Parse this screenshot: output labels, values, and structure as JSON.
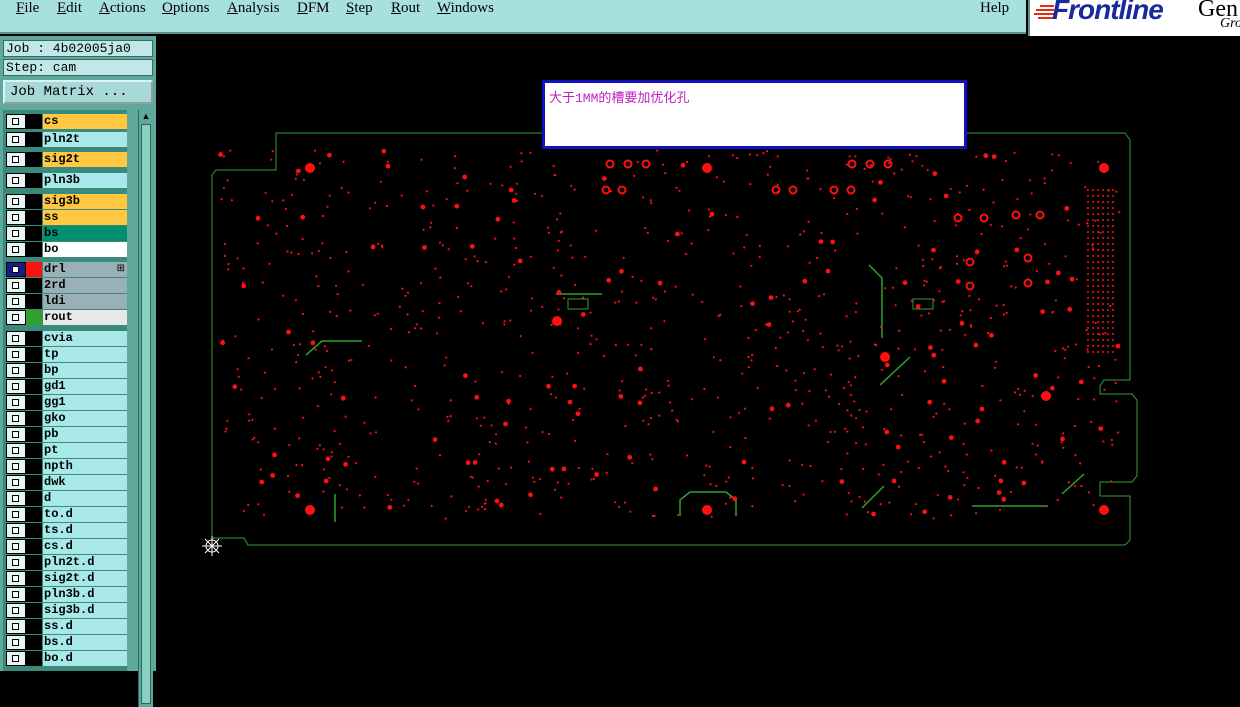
{
  "menu": {
    "file": {
      "u": "F",
      "rest": "ile"
    },
    "edit": {
      "u": "E",
      "rest": "dit"
    },
    "actions": {
      "u": "A",
      "rest": "ctions"
    },
    "options": {
      "u": "O",
      "rest": "ptions"
    },
    "analysis": {
      "u": "A",
      "rest": "nalysis"
    },
    "dfm": {
      "u": "D",
      "rest": "FM"
    },
    "step": {
      "u": "S",
      "rest": "tep"
    },
    "rout": {
      "u": "R",
      "rest": "out"
    },
    "windows": {
      "u": "W",
      "rest": "indows"
    },
    "help": "Help"
  },
  "logo": {
    "brand": "Frontline",
    "tail": "Gen",
    "sub": "Gro"
  },
  "job": {
    "job_line": "Job : 4b02005ja0",
    "step_line": "Step: cam",
    "matrix_button": "Job Matrix ..."
  },
  "layers": [
    {
      "name": "cs",
      "bg": "#ffc840",
      "swatch": "#000000"
    },
    {
      "name": "pln2t",
      "bg": "#a8e8e8",
      "swatch": "#000000"
    },
    {
      "name": "sig2t",
      "bg": "#ffc840",
      "swatch": "#000000"
    },
    {
      "name": "pln3b",
      "bg": "#a8e8e8",
      "swatch": "#000000"
    },
    {
      "name": "sig3b",
      "bg": "#ffc840",
      "swatch": "#000000"
    },
    {
      "name": "ss",
      "bg": "#ffc840",
      "swatch": "#000000"
    },
    {
      "name": "bs",
      "bg": "#009070",
      "swatch": "#000000"
    },
    {
      "name": "bo",
      "bg": "#ffffff",
      "swatch": "#000000"
    },
    {
      "name": "drl",
      "bg": "#9ab0b8",
      "swatch": "#ff1010",
      "selected": true,
      "plus": "⊞"
    },
    {
      "name": "2rd",
      "bg": "#9ab0b8",
      "swatch": "#000000"
    },
    {
      "name": "ldi",
      "bg": "#9ab0b8",
      "swatch": "#000000"
    },
    {
      "name": "rout",
      "bg": "#e8e8e8",
      "swatch": "#30a030"
    },
    {
      "name": "cvia",
      "bg": "#a8e8e8",
      "swatch": "#000000"
    },
    {
      "name": "tp",
      "bg": "#a8e8e8",
      "swatch": "#000000"
    },
    {
      "name": "bp",
      "bg": "#a8e8e8",
      "swatch": "#000000"
    },
    {
      "name": "gd1",
      "bg": "#a8e8e8",
      "swatch": "#000000"
    },
    {
      "name": "gg1",
      "bg": "#a8e8e8",
      "swatch": "#000000"
    },
    {
      "name": "gko",
      "bg": "#a8e8e8",
      "swatch": "#000000"
    },
    {
      "name": "pb",
      "bg": "#a8e8e8",
      "swatch": "#000000"
    },
    {
      "name": "pt",
      "bg": "#a8e8e8",
      "swatch": "#000000"
    },
    {
      "name": "npth",
      "bg": "#a8e8e8",
      "swatch": "#000000"
    },
    {
      "name": "dwk",
      "bg": "#a8e8e8",
      "swatch": "#000000"
    },
    {
      "name": "d",
      "bg": "#a8e8e8",
      "swatch": "#000000"
    },
    {
      "name": "to.d",
      "bg": "#a8e8e8",
      "swatch": "#000000"
    },
    {
      "name": "ts.d",
      "bg": "#a8e8e8",
      "swatch": "#000000"
    },
    {
      "name": "cs.d",
      "bg": "#a8e8e8",
      "swatch": "#000000"
    },
    {
      "name": "pln2t.d",
      "bg": "#a8e8e8",
      "swatch": "#000000"
    },
    {
      "name": "sig2t.d",
      "bg": "#a8e8e8",
      "swatch": "#000000"
    },
    {
      "name": "pln3b.d",
      "bg": "#a8e8e8",
      "swatch": "#000000"
    },
    {
      "name": "sig3b.d",
      "bg": "#a8e8e8",
      "swatch": "#000000"
    },
    {
      "name": "ss.d",
      "bg": "#a8e8e8",
      "swatch": "#000000"
    },
    {
      "name": "bs.d",
      "bg": "#a8e8e8",
      "swatch": "#000000"
    },
    {
      "name": "bo.d",
      "bg": "#a8e8e8",
      "swatch": "#000000"
    }
  ],
  "note": "大于1MM的槽要加优化孔",
  "colors": {
    "pad": "#ff1010",
    "outline": "#30a030",
    "note_text": "#c020c0",
    "note_border": "#1010c0"
  },
  "icons": {
    "scroll_up": "▲"
  }
}
